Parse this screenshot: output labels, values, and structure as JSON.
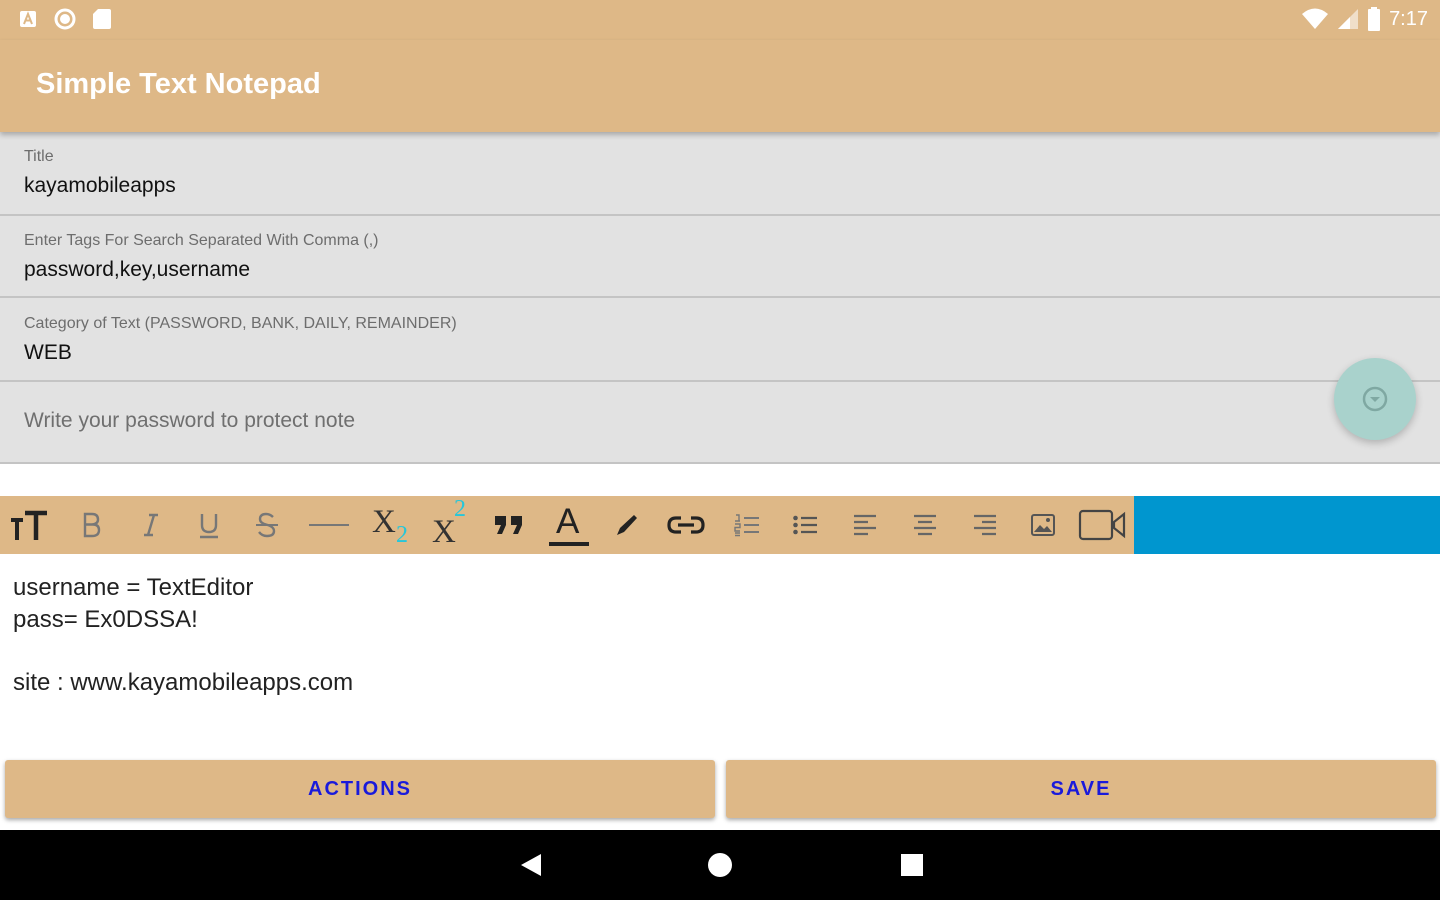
{
  "status_bar": {
    "time": "7:17",
    "left_icons": [
      "a-letter-icon",
      "record-icon",
      "sd-card-icon"
    ],
    "right_icons": [
      "wifi-icon",
      "cell-signal-icon",
      "battery-icon"
    ]
  },
  "app_bar": {
    "title": "Simple Text Notepad"
  },
  "form": {
    "title_label": "Title",
    "title_value": "kayamobileapps",
    "tags_label": "Enter Tags For Search Separated With Comma (,)",
    "tags_value": "password,key,username",
    "category_label": "Category of Text (PASSWORD, BANK, DAILY, REMAINDER)",
    "category_value": "WEB",
    "password_placeholder": "Write your password to protect note"
  },
  "toolbar": {
    "tools": [
      "text-size",
      "bold",
      "italic",
      "underline",
      "strikethrough",
      "horizontal-rule",
      "subscript",
      "superscript",
      "blockquote",
      "text-color",
      "highlight",
      "link",
      "numbered-list",
      "bullet-list",
      "align-left",
      "align-center",
      "align-right",
      "image",
      "video"
    ],
    "subscript_base": "X",
    "subscript_sub": "2",
    "superscript_base": "X",
    "superscript_sup": "2",
    "text_color_letter": "A"
  },
  "editor": {
    "lines": [
      "username = TextEditor",
      "pass= Ex0DSSA!",
      "",
      "site : www.kayamobileapps.com"
    ]
  },
  "buttons": {
    "actions": "ACTIONS",
    "save": "SAVE"
  },
  "nav_bar": {
    "buttons": [
      "back",
      "home",
      "recents"
    ]
  },
  "colors": {
    "primary": "#deb887",
    "toolbar_accent": "#0096cf",
    "button_text": "#1a1adb",
    "field_bg": "#e2e2e2",
    "fab": "#a9d2cc",
    "subscript_accent": "#26c6da"
  }
}
